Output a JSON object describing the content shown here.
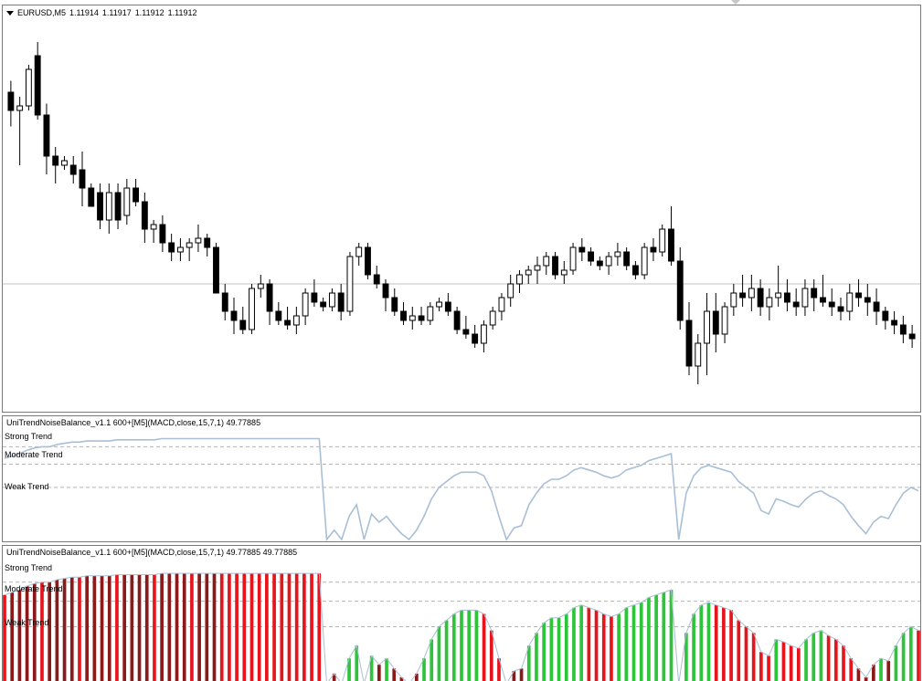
{
  "chart": {
    "symbol_label": "EURUSD,M5",
    "open": "1.11914",
    "high": "1.11917",
    "low": "1.11912",
    "close": "1.11912"
  },
  "indicator1": {
    "title": "UniTrendNoiseBalance_v1.1 600+[M5](MACD,close,15,7,1) 49.77885",
    "levels": [
      "Strong Trend",
      "Moderate Trend",
      "Weak Trend"
    ]
  },
  "indicator2": {
    "title": "UniTrendNoiseBalance_v1.1 600+[M5](MACD,close,15,7,1) 49.77885 49.77885",
    "levels": [
      "Strong Trend",
      "Moderate Trend",
      "Weak Trend"
    ]
  },
  "colors": {
    "bull_candle": "#ffffff",
    "bear_candle": "#000000",
    "indicator_line": "#a9bfd6",
    "hist_red": "#e8141c",
    "hist_darkred": "#8b1a1a",
    "hist_green": "#2ec43a",
    "level_dash": "#b4b4b4"
  },
  "chart_data": [
    {
      "type": "candlestick",
      "title": "EURUSD,M5",
      "series": [
        {
          "name": "EURUSD,M5",
          "ohlc": [
            [
              80,
              85,
              65,
              72
            ],
            [
              72,
              78,
              48,
              74
            ],
            [
              74,
              92,
              72,
              90
            ],
            [
              96,
              102,
              68,
              70
            ],
            [
              70,
              75,
              44,
              52
            ],
            [
              52,
              56,
              40,
              48
            ],
            [
              48,
              52,
              46,
              50
            ],
            [
              48,
              52,
              40,
              44
            ],
            [
              46,
              54,
              30,
              38
            ],
            [
              38,
              40,
              30,
              30
            ],
            [
              36,
              40,
              20,
              24
            ],
            [
              24,
              40,
              18,
              36
            ],
            [
              36,
              40,
              20,
              24
            ],
            [
              26,
              42,
              22,
              38
            ],
            [
              38,
              42,
              30,
              32
            ],
            [
              32,
              36,
              14,
              20
            ],
            [
              20,
              24,
              14,
              22
            ],
            [
              22,
              26,
              10,
              14
            ],
            [
              14,
              18,
              6,
              10
            ],
            [
              10,
              16,
              6,
              12
            ],
            [
              12,
              16,
              6,
              14
            ],
            [
              14,
              22,
              10,
              16
            ],
            [
              16,
              18,
              8,
              12
            ],
            [
              12,
              14,
              -4,
              -8
            ],
            [
              -8,
              -4,
              -20,
              -16
            ],
            [
              -16,
              -10,
              -26,
              -20
            ],
            [
              -20,
              -14,
              -26,
              -24
            ],
            [
              -24,
              -4,
              -26,
              -6
            ],
            [
              -6,
              0,
              -10,
              -4
            ],
            [
              -4,
              -2,
              -22,
              -16
            ],
            [
              -16,
              -12,
              -22,
              -20
            ],
            [
              -20,
              -14,
              -24,
              -22
            ],
            [
              -22,
              -14,
              -26,
              -18
            ],
            [
              -18,
              -6,
              -22,
              -8
            ],
            [
              -8,
              -2,
              -14,
              -12
            ],
            [
              -12,
              -10,
              -16,
              -14
            ],
            [
              -14,
              -6,
              -16,
              -8
            ],
            [
              -8,
              -4,
              -20,
              -16
            ],
            [
              -16,
              10,
              -18,
              8
            ],
            [
              8,
              14,
              4,
              12
            ],
            [
              12,
              14,
              -2,
              0
            ],
            [
              0,
              4,
              -6,
              -4
            ],
            [
              -4,
              -2,
              -16,
              -10
            ],
            [
              -10,
              -6,
              -18,
              -16
            ],
            [
              -16,
              -12,
              -22,
              -20
            ],
            [
              -20,
              -14,
              -24,
              -18
            ],
            [
              -18,
              -14,
              -22,
              -20
            ],
            [
              -20,
              -12,
              -22,
              -14
            ],
            [
              -14,
              -10,
              -16,
              -12
            ],
            [
              -12,
              -8,
              -18,
              -16
            ],
            [
              -16,
              -14,
              -26,
              -24
            ],
            [
              -24,
              -18,
              -28,
              -26
            ],
            [
              -26,
              -22,
              -32,
              -30
            ],
            [
              -30,
              -20,
              -34,
              -22
            ],
            [
              -22,
              -14,
              -24,
              -16
            ],
            [
              -16,
              -8,
              -20,
              -10
            ],
            [
              -10,
              0,
              -14,
              -4
            ],
            [
              -4,
              2,
              -8,
              0
            ],
            [
              0,
              4,
              -4,
              2
            ],
            [
              2,
              8,
              -4,
              4
            ],
            [
              4,
              10,
              0,
              8
            ],
            [
              8,
              10,
              -2,
              0
            ],
            [
              0,
              6,
              -4,
              2
            ],
            [
              2,
              14,
              0,
              12
            ],
            [
              12,
              16,
              6,
              10
            ],
            [
              10,
              12,
              4,
              6
            ],
            [
              6,
              8,
              2,
              4
            ],
            [
              4,
              10,
              0,
              8
            ],
            [
              8,
              14,
              4,
              10
            ],
            [
              10,
              12,
              2,
              4
            ],
            [
              4,
              6,
              -2,
              0
            ],
            [
              0,
              14,
              -2,
              12
            ],
            [
              12,
              16,
              6,
              10
            ],
            [
              10,
              22,
              8,
              20
            ],
            [
              20,
              30,
              4,
              6
            ],
            [
              6,
              12,
              -24,
              -20
            ],
            [
              -20,
              -12,
              -44,
              -40
            ],
            [
              -40,
              -26,
              -48,
              -30
            ],
            [
              -30,
              -8,
              -44,
              -16
            ],
            [
              -16,
              -8,
              -34,
              -26
            ],
            [
              -26,
              -12,
              -30,
              -14
            ],
            [
              -14,
              -4,
              -18,
              -8
            ],
            [
              -8,
              0,
              -14,
              -10
            ],
            [
              -10,
              0,
              -16,
              -6
            ],
            [
              -6,
              -2,
              -18,
              -14
            ],
            [
              -14,
              -6,
              -20,
              -10
            ],
            [
              -10,
              4,
              -14,
              -8
            ],
            [
              -8,
              -2,
              -16,
              -12
            ],
            [
              -12,
              -6,
              -18,
              -14
            ],
            [
              -14,
              -2,
              -18,
              -6
            ],
            [
              -6,
              -2,
              -16,
              -10
            ],
            [
              -10,
              0,
              -14,
              -12
            ],
            [
              -12,
              -6,
              -18,
              -14
            ],
            [
              -14,
              -10,
              -20,
              -16
            ],
            [
              -16,
              -4,
              -20,
              -8
            ],
            [
              -8,
              -2,
              -14,
              -10
            ],
            [
              -10,
              -4,
              -18,
              -12
            ],
            [
              -12,
              -6,
              -22,
              -16
            ],
            [
              -16,
              -14,
              -24,
              -20
            ],
            [
              -20,
              -16,
              -26,
              -22
            ],
            [
              -22,
              -18,
              -30,
              -26
            ],
            [
              -26,
              -22,
              -32,
              -28
            ]
          ]
        }
      ],
      "horizontal_line": -4
    },
    {
      "type": "line",
      "title": "UniTrendNoiseBalance_v1.1 600+[M5](MACD,close,15,7,1) 49.77885",
      "levels": [
        80,
        65,
        45
      ],
      "ylim": [
        0,
        100
      ],
      "series": [
        {
          "name": "UniTrendNoiseBalance_v1.1",
          "values": [
            70,
            72,
            74,
            77,
            79,
            80,
            80,
            82,
            83,
            84,
            84,
            85,
            85,
            85,
            85,
            86,
            86,
            86,
            86,
            86,
            86,
            87,
            87,
            87,
            87,
            87,
            87,
            87,
            87,
            87,
            87,
            87,
            87,
            87,
            87,
            87,
            87,
            87,
            87,
            87,
            87,
            87,
            87,
            0,
            8,
            0,
            20,
            30,
            0,
            22,
            15,
            20,
            12,
            5,
            0,
            8,
            20,
            35,
            45,
            50,
            55,
            58,
            58,
            58,
            55,
            42,
            20,
            0,
            10,
            12,
            30,
            40,
            48,
            52,
            52,
            55,
            60,
            62,
            60,
            58,
            55,
            53,
            55,
            60,
            62,
            64,
            68,
            70,
            72,
            74,
            0,
            40,
            55,
            62,
            64,
            62,
            60,
            58,
            50,
            45,
            40,
            25,
            22,
            35,
            33,
            30,
            28,
            35,
            40,
            42,
            38,
            35,
            30,
            20,
            12,
            5,
            15,
            20,
            18,
            30,
            40,
            45,
            42
          ]
        }
      ]
    },
    {
      "type": "bar",
      "title": "UniTrendNoiseBalance_v1.1 600+[M5](MACD,close,15,7,1) 49.77885 49.77885",
      "levels": [
        80,
        65,
        45
      ],
      "ylim": [
        0,
        100
      ],
      "series": [
        {
          "name": "UniTrendNoiseBalance_v1.1",
          "values": [
            70,
            72,
            74,
            77,
            79,
            80,
            80,
            82,
            83,
            84,
            84,
            85,
            85,
            85,
            85,
            86,
            86,
            86,
            86,
            86,
            86,
            87,
            87,
            87,
            87,
            87,
            87,
            87,
            87,
            87,
            87,
            87,
            87,
            87,
            87,
            87,
            87,
            87,
            87,
            87,
            87,
            87,
            87,
            0,
            8,
            0,
            20,
            30,
            0,
            22,
            15,
            20,
            12,
            5,
            0,
            8,
            20,
            35,
            45,
            50,
            55,
            58,
            58,
            58,
            55,
            42,
            20,
            0,
            10,
            12,
            30,
            40,
            48,
            52,
            52,
            55,
            60,
            62,
            60,
            58,
            55,
            53,
            55,
            60,
            62,
            64,
            68,
            70,
            72,
            74,
            0,
            40,
            55,
            62,
            64,
            62,
            60,
            58,
            50,
            45,
            40,
            25,
            22,
            35,
            33,
            30,
            28,
            35,
            40,
            42,
            38,
            35,
            30,
            20,
            12,
            5,
            15,
            20,
            18,
            30,
            40,
            45,
            42
          ]
        }
      ]
    }
  ]
}
